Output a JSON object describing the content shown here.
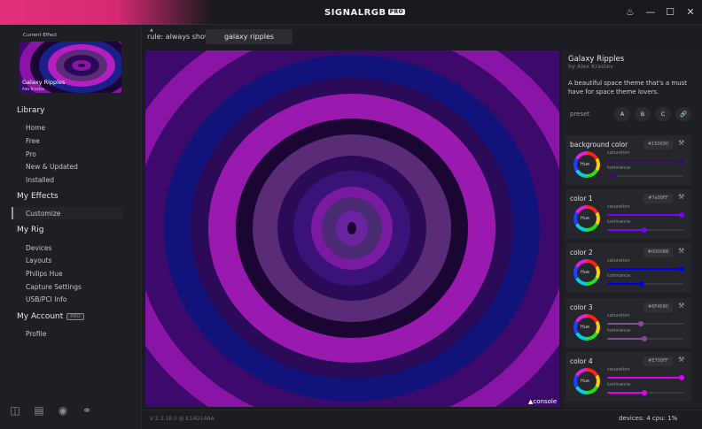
{
  "app": {
    "brand": "SIGNALRGB",
    "brand_badge": "PRO",
    "accent": "#e0307a"
  },
  "window_controls": [
    {
      "name": "notifications-icon",
      "glyph": "🔔"
    },
    {
      "name": "minimize-icon",
      "glyph": "—"
    },
    {
      "name": "maximize-icon",
      "glyph": "☐"
    },
    {
      "name": "close-icon",
      "glyph": "✕"
    }
  ],
  "sidebar": {
    "current_effect_label": "Current Effect",
    "thumb_title": "Galaxy Ripples",
    "thumb_author": "Alex Krastev",
    "library_label": "Library",
    "library_items": [
      "Home",
      "Free",
      "Pro",
      "New & Updated",
      "Installed"
    ],
    "my_effects_label": "My Effects",
    "my_effects_items": [
      "Customize"
    ],
    "my_rig_label": "My Rig",
    "my_rig_items": [
      "Devices",
      "Layouts",
      "Philips Hue",
      "Capture Settings",
      "USB/PCI Info"
    ],
    "my_account_label": "My Account",
    "my_account_badge": "PRO",
    "my_account_items": [
      "Profile"
    ],
    "bottom_icons": [
      "book-icon",
      "library-icon",
      "discord-icon",
      "support-icon"
    ]
  },
  "topbar": {
    "rule_text": "rule: always show",
    "effect_selector": "galaxy ripples"
  },
  "canvas": {
    "console_label": "console",
    "ripple_colors": [
      "#1b0633",
      "#0e1282",
      "#3b0a6a",
      "#8a14a6",
      "#5a2c78",
      "#2a0a56"
    ]
  },
  "effect_info": {
    "title": "Galaxy Ripples",
    "author": "by Alex Krastev",
    "description": "A beautiful space theme that's a must have for space theme lovers.",
    "preset_label": "preset",
    "preset_buttons": [
      "A",
      "B",
      "C"
    ]
  },
  "color_cards": [
    {
      "title": "background color",
      "hex": "#150030",
      "saturation": 1.0,
      "luminance": 0.1,
      "accent": "#3a0a6a"
    },
    {
      "title": "color 1",
      "hex": "#7a00FF",
      "saturation": 1.0,
      "luminance": 0.5,
      "accent": "#7a00ff"
    },
    {
      "title": "color 2",
      "hex": "#0000BB",
      "saturation": 1.0,
      "luminance": 0.47,
      "accent": "#0000dd"
    },
    {
      "title": "color 3",
      "hex": "#6F4580",
      "saturation": 0.45,
      "luminance": 0.5,
      "accent": "#8a4a9a"
    },
    {
      "title": "color 4",
      "hex": "#E700FF",
      "saturation": 1.0,
      "luminance": 0.5,
      "accent": "#e000f0"
    }
  ],
  "labels": {
    "hue": "Hue",
    "saturation": "saturation",
    "luminance": "luminance"
  },
  "status": {
    "version": "V 2.3.18.0 @ E14D14AA",
    "devices_cpu": "devices: 4  cpu: 1%"
  }
}
